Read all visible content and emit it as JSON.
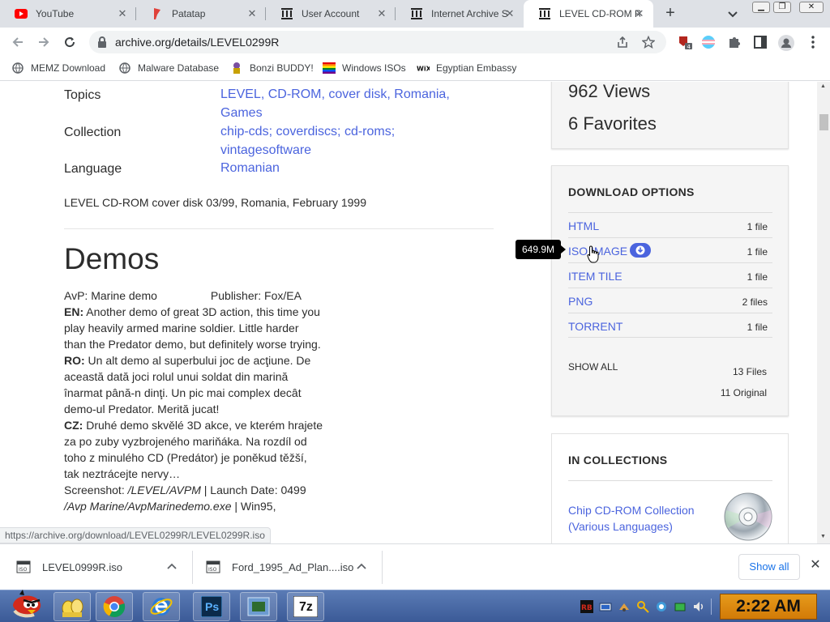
{
  "tabs": [
    {
      "label": "YouTube",
      "icon": "youtube-icon"
    },
    {
      "label": "Patatap",
      "icon": "patatap-icon"
    },
    {
      "label": "User Account",
      "icon": "archive-icon"
    },
    {
      "label": "Internet Archive S",
      "icon": "archive-icon"
    },
    {
      "label": "LEVEL CD-ROM R",
      "icon": "archive-icon",
      "active": true
    }
  ],
  "omnibox": {
    "url": "archive.org/details/LEVEL0299R"
  },
  "bookmarks": [
    {
      "label": "MEMZ Download",
      "icon": "globe-icon"
    },
    {
      "label": "Malware Database",
      "icon": "globe-icon"
    },
    {
      "label": "Bonzi BUDDY!",
      "icon": "bonzi-icon"
    },
    {
      "label": "Windows ISOs",
      "icon": "windows-flag-icon"
    },
    {
      "label": "Egyptian Embassy",
      "icon": "wix-icon"
    }
  ],
  "metadata": {
    "topics_label": "Topics",
    "topics": [
      "LEVEL",
      "CD-ROM",
      "cover disk",
      "Romania",
      "Games"
    ],
    "collection_label": "Collection",
    "collections": [
      "chip-cds",
      "coverdiscs",
      "cd-roms",
      "vintagesoftware"
    ],
    "language_label": "Language",
    "language": "Romanian",
    "description": "LEVEL CD-ROM cover disk 03/99, Romania, February 1999"
  },
  "demos": {
    "title": "Demos",
    "item_name": "AvP: Marine demo",
    "item_publisher": "Publisher: Fox/EA",
    "en_label": "EN:",
    "en_text": " Another demo of great 3D action, this time you play heavily armed marine soldier. Little harder than the Predator demo, but definitely worse trying.",
    "ro_label": "RO:",
    "ro_text": " Un alt demo al superbului joc de acţiune. De această dată joci rolul unui soldat din marină înarmat până-n dinţi. Un pic mai complex decât demo-ul Predator. Merită jucat!",
    "cz_label": "CZ:",
    "cz_text": " Druhé demo skvělé 3D akce, ve kterém hrajete za po zuby vyzbrojeného mariňáka. Na rozdíl od toho z minulého CD (Predátor) je poněkud těžší, tak neztrácejte nervy…",
    "screenshot_label": "Screenshot: ",
    "screenshot_path": "/LEVEL/AVPM",
    "launch_date": " | Launch Date: 0499",
    "exe_path": "/Avp Marine/AvpMarinedemo.exe",
    "platform": " | Win95,"
  },
  "stats": {
    "views": "962 Views",
    "favorites": "6 Favorites"
  },
  "download_options": {
    "heading": "DOWNLOAD OPTIONS",
    "rows": [
      {
        "name": "HTML",
        "count": "1 file"
      },
      {
        "name": "ISO IMAGE",
        "count": "1 file"
      },
      {
        "name": "ITEM TILE",
        "count": "1 file"
      },
      {
        "name": "PNG",
        "count": "2 files"
      },
      {
        "name": "TORRENT",
        "count": "1 file"
      }
    ],
    "show_all": "SHOW ALL",
    "total_files": "13 Files",
    "original": "11 Original"
  },
  "tooltip": "649.9M",
  "collections_card": {
    "heading": "IN COLLECTIONS",
    "link": "Chip CD-ROM Collection (Various Languages)"
  },
  "status_url": "https://archive.org/download/LEVEL0299R/LEVEL0299R.iso",
  "downloads": [
    {
      "filename": "LEVEL0999R.iso"
    },
    {
      "filename": "Ford_1995_Ad_Plan....iso"
    }
  ],
  "shelf": {
    "show_all": "Show all"
  },
  "taskbar": {
    "apps": [
      "angry-bird-start-icon",
      "bonzi-eggs-icon",
      "chrome-icon",
      "internet-explorer-icon",
      "photoshop-icon",
      "window-icon",
      "7zip-icon"
    ],
    "photoshop_label": "Ps",
    "sevenzip_label": "7z",
    "clock": "2:22 AM"
  },
  "colors": {
    "link": "#4b64de",
    "text": "#2c2c2c",
    "clock": "#e69a1b",
    "taskbar": "#3b5a97"
  }
}
